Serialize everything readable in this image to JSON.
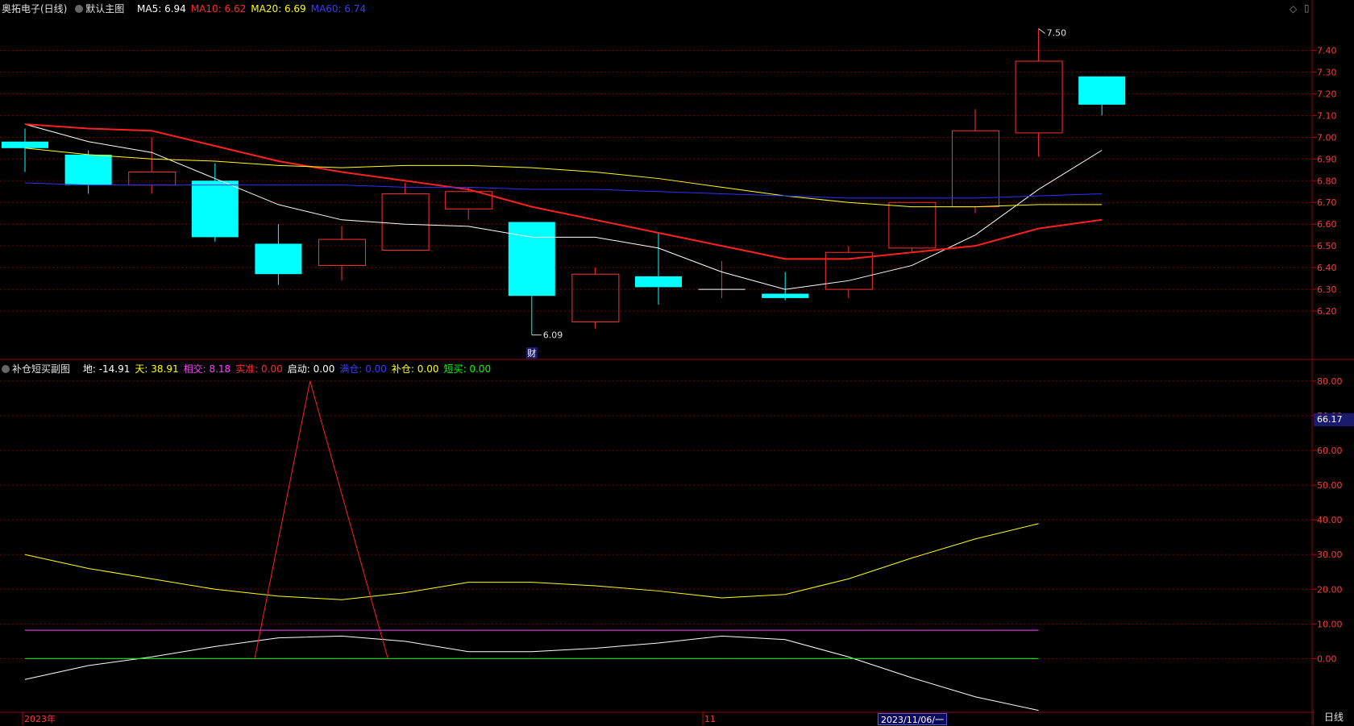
{
  "main_panel": {
    "title": "奥拓电子(日线)",
    "template_label": "默认主图",
    "ma_labels": [
      {
        "text": "MA5: 6.94",
        "color": "#ffffff"
      },
      {
        "text": "MA10: 6.62",
        "color": "#ff2a2a"
      },
      {
        "text": "MA20: 6.69",
        "color": "#ffff00"
      },
      {
        "text": "MA60: 6.74",
        "color": "#3a3aff"
      }
    ],
    "max_label": "7.50",
    "min_label": "6.09",
    "event_marker": "财"
  },
  "sub_panel": {
    "title": "补仓短买副图",
    "indicators": [
      {
        "text": "地: -14.91",
        "color": "#ffffff"
      },
      {
        "text": "天: 38.91",
        "color": "#ffff00"
      },
      {
        "text": "相交: 8.18",
        "color": "#ff40ff"
      },
      {
        "text": "实准: 0.00",
        "color": "#ff2a2a"
      },
      {
        "text": "启动: 0.00",
        "color": "#ffffff"
      },
      {
        "text": "满仓: 0.00",
        "color": "#3a3aff"
      },
      {
        "text": "补仓: 0.00",
        "color": "#ffff00"
      },
      {
        "text": "短买: 0.00",
        "color": "#00ff00"
      }
    ],
    "current_value_badge": "66.17"
  },
  "bottom_bar": {
    "year_label": "2023年",
    "month_label": "11",
    "cursor_date": "2023/11/06/一",
    "period_label": "日线"
  },
  "colors": {
    "up_candle": "#ff3030",
    "down_candle": "#00ffff",
    "grid": "#7a0000",
    "axis_text": "#ff3a3a"
  },
  "chart_data": [
    {
      "type": "candlestick",
      "title": "奥拓电子(日线)",
      "ylim": [
        6.0,
        7.55
      ],
      "y_ticks": [
        "7.40",
        "7.30",
        "7.20",
        "7.10",
        "7.00",
        "6.90",
        "6.80",
        "6.70",
        "6.60",
        "6.50",
        "6.40",
        "6.30",
        "6.20"
      ],
      "candles": [
        {
          "open": 6.98,
          "high": 7.04,
          "low": 6.84,
          "close": 6.95
        },
        {
          "open": 6.92,
          "high": 6.94,
          "low": 6.74,
          "close": 6.78
        },
        {
          "open": 6.78,
          "high": 7.0,
          "low": 6.74,
          "close": 6.84
        },
        {
          "open": 6.8,
          "high": 6.88,
          "low": 6.52,
          "close": 6.54
        },
        {
          "open": 6.51,
          "high": 6.6,
          "low": 6.32,
          "close": 6.37
        },
        {
          "open": 6.41,
          "high": 6.59,
          "low": 6.34,
          "close": 6.53
        },
        {
          "open": 6.48,
          "high": 6.79,
          "low": 6.48,
          "close": 6.74
        },
        {
          "open": 6.67,
          "high": 6.77,
          "low": 6.62,
          "close": 6.75
        },
        {
          "open": 6.61,
          "high": 6.61,
          "low": 6.09,
          "close": 6.27
        },
        {
          "open": 6.15,
          "high": 6.4,
          "low": 6.12,
          "close": 6.37
        },
        {
          "open": 6.36,
          "high": 6.56,
          "low": 6.23,
          "close": 6.31
        },
        {
          "open": 6.3,
          "high": 6.43,
          "low": 6.26,
          "close": 6.3
        },
        {
          "open": 6.28,
          "high": 6.38,
          "low": 6.25,
          "close": 6.26
        },
        {
          "open": 6.3,
          "high": 6.5,
          "low": 6.26,
          "close": 6.47
        },
        {
          "open": 6.49,
          "high": 6.7,
          "low": 6.47,
          "close": 6.7
        },
        {
          "open": 6.68,
          "high": 7.13,
          "low": 6.65,
          "close": 7.03
        },
        {
          "open": 7.02,
          "high": 7.5,
          "low": 6.91,
          "close": 7.35
        },
        {
          "open": 7.28,
          "high": 7.28,
          "low": 7.1,
          "close": 7.15
        }
      ],
      "series": [
        {
          "name": "MA5",
          "color": "#ffffff",
          "values": [
            7.06,
            6.98,
            6.93,
            6.81,
            6.69,
            6.62,
            6.6,
            6.59,
            6.54,
            6.54,
            6.49,
            6.38,
            6.3,
            6.34,
            6.41,
            6.55,
            6.76,
            6.94
          ]
        },
        {
          "name": "MA10",
          "color": "#ff2020",
          "values": [
            7.06,
            7.04,
            7.03,
            6.96,
            6.89,
            6.84,
            6.8,
            6.76,
            6.68,
            6.62,
            6.56,
            6.5,
            6.44,
            6.44,
            6.47,
            6.5,
            6.58,
            6.62
          ]
        },
        {
          "name": "MA20",
          "color": "#ffff00",
          "values": [
            6.95,
            6.92,
            6.9,
            6.89,
            6.87,
            6.86,
            6.87,
            6.87,
            6.86,
            6.84,
            6.81,
            6.77,
            6.73,
            6.7,
            6.68,
            6.68,
            6.69,
            6.69
          ]
        },
        {
          "name": "MA60",
          "color": "#3030ff",
          "values": [
            6.79,
            6.78,
            6.78,
            6.78,
            6.78,
            6.78,
            6.77,
            6.77,
            6.76,
            6.76,
            6.75,
            6.74,
            6.73,
            6.72,
            6.72,
            6.72,
            6.73,
            6.74
          ]
        }
      ]
    },
    {
      "type": "line",
      "title": "补仓短买副图",
      "ylim": [
        -15,
        83
      ],
      "y_ticks": [
        "80.00",
        "70.00",
        "60.00",
        "50.00",
        "40.00",
        "30.00",
        "20.00",
        "10.00",
        "0.00"
      ],
      "series": [
        {
          "name": "地",
          "color": "#ffffff",
          "values": [
            -6,
            -2,
            0.5,
            3.5,
            6,
            6.5,
            5,
            2,
            2,
            3,
            4.5,
            6.5,
            5.5,
            0.5,
            -5.5,
            -11,
            -14.91
          ]
        },
        {
          "name": "天",
          "color": "#ffff00",
          "values": [
            30,
            26,
            23,
            20,
            18,
            17,
            19,
            22,
            22,
            21,
            19.5,
            17.5,
            18.5,
            23,
            29,
            34.5,
            38.91
          ]
        },
        {
          "name": "相交",
          "color": "#ff40ff",
          "values": [
            8.18,
            8.18,
            8.18,
            8.18,
            8.18,
            8.18,
            8.18,
            8.18,
            8.18,
            8.18,
            8.18,
            8.18,
            8.18,
            8.18,
            8.18,
            8.18,
            8.18
          ]
        },
        {
          "name": "短买",
          "color": "#00ff00",
          "values": [
            0,
            0,
            0,
            0,
            0,
            0,
            0,
            0,
            0,
            0,
            0,
            0,
            0,
            0,
            0,
            0,
            0
          ]
        }
      ],
      "spike": {
        "color": "#ff2020",
        "base": 0,
        "peak": 80
      }
    }
  ]
}
